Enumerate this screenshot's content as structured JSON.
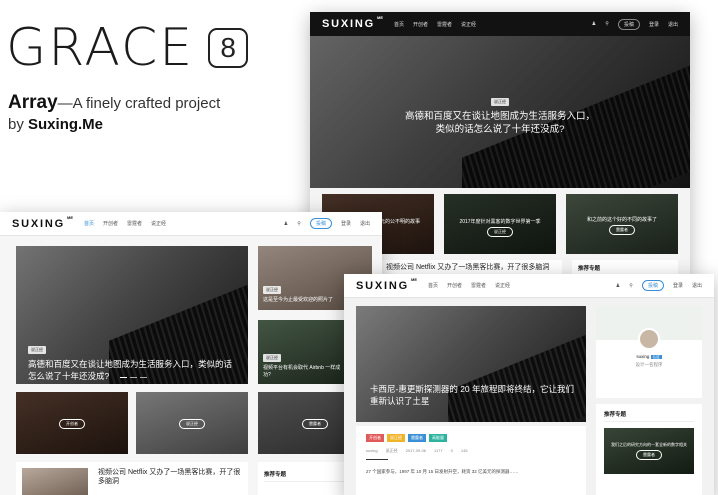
{
  "brand": {
    "word": "GRACE",
    "version": "8",
    "array": "Array",
    "tagline_rest": "—A finely crafted project",
    "by": "by ",
    "author": "Suxing.Me"
  },
  "site": {
    "logo": "SUXING",
    "logo_sup": "ME",
    "nav": [
      "首页",
      "开创者",
      "雷霆者",
      "说正经"
    ],
    "nav_b": [
      "首页",
      "开创者",
      "雷霆者",
      "说正经"
    ],
    "pill": "投稿",
    "login": "登录",
    "register": "退出"
  },
  "win_top": {
    "hero_tag": "说正经",
    "hero_title": "高德和百度又在谈让地图成为生活服务入口，类似的话怎么说了十年还没成?",
    "cards": [
      {
        "title": "一条关于我们 8000 元的公不明的故事",
        "btn": "雷霆者"
      },
      {
        "title": "2017年度针对黑客的数字世界第一季",
        "btn": "说正经"
      },
      {
        "title": "和之前的这个好的不同的故事了",
        "btn": "雷霆者"
      }
    ],
    "article": "视频公司 Netflix 又办了一场黑客比赛，开了很多脑洞",
    "side_title": "推荐专题"
  },
  "win_left": {
    "hero_tag": "说正经",
    "hero_title": "高德和百度又在谈让地图成为生活服务入口，类似的话怎么说了十年还没成?",
    "side_cards": [
      {
        "tag": "说正经",
        "title": "这是至今为止最受欢迎的照片了"
      },
      {
        "tag": "说正经",
        "title": "视频平台有机会取代 Airbnb 一样成功?"
      }
    ],
    "mini": [
      {
        "btn": "开创者"
      },
      {
        "btn": "说正经"
      },
      {
        "btn": "雷霆者"
      }
    ],
    "article": "视频公司 Netflix 又办了一场黑客比赛，开了很多脑洞",
    "side_title": "推荐专题"
  },
  "win_right": {
    "hero_title": "卡西尼-惠更斯探测器的 20 年旅程即将终结，它让我们重新认识了土星",
    "tags": [
      "开创者",
      "说正经",
      "雷霆者",
      "高能量"
    ],
    "meta": [
      "suxing",
      "说正经",
      "2017-09-06",
      "1177",
      "0",
      "145"
    ],
    "body": "27 个国家参与，1997 年 10 月 15 日发射升空，耗资 32 亿美元的探测器……",
    "profile_name": "suxing",
    "profile_badge": "认证",
    "profile_desc": "设计一名程序",
    "side_title": "推荐专题",
    "side_card": {
      "title": "我们之后的研究方向的一套全新的数字相关",
      "btn": "雷霆者"
    }
  },
  "colors": {
    "accent": "#3a8fd6",
    "dark_nav": "#121212"
  }
}
